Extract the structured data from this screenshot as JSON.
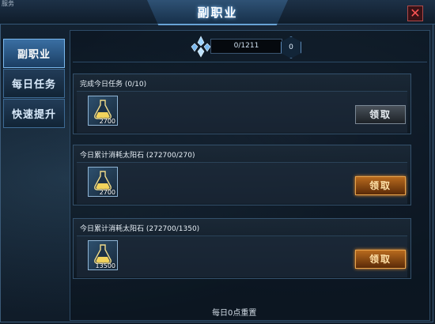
{
  "window": {
    "title": "副职业",
    "corner_label": "服务",
    "close_glyph": "✕"
  },
  "sidebar": {
    "tabs": [
      {
        "label": "副职业",
        "active": true
      },
      {
        "label": "每日任务",
        "active": false
      },
      {
        "label": "快速提升",
        "active": false
      }
    ]
  },
  "header": {
    "progress": "0/1211",
    "hex_value": "0",
    "crystal_icon": "crystal-icon"
  },
  "tasks": [
    {
      "title": "完成今日任务 (0/10)",
      "reward_count": "2700",
      "button_label": "领取",
      "button_enabled": false
    },
    {
      "title": "今日累计消耗太阳石 (272700/270)",
      "reward_count": "2700",
      "button_label": "领取",
      "button_enabled": true
    },
    {
      "title": "今日累计消耗太阳石 (272700/1350)",
      "reward_count": "13500",
      "button_label": "领取",
      "button_enabled": true
    }
  ],
  "footer": {
    "note": "每日0点重置"
  },
  "colors": {
    "accent": "#68a3d6",
    "claim_active": "#e8a34c",
    "close": "#ff5555"
  }
}
